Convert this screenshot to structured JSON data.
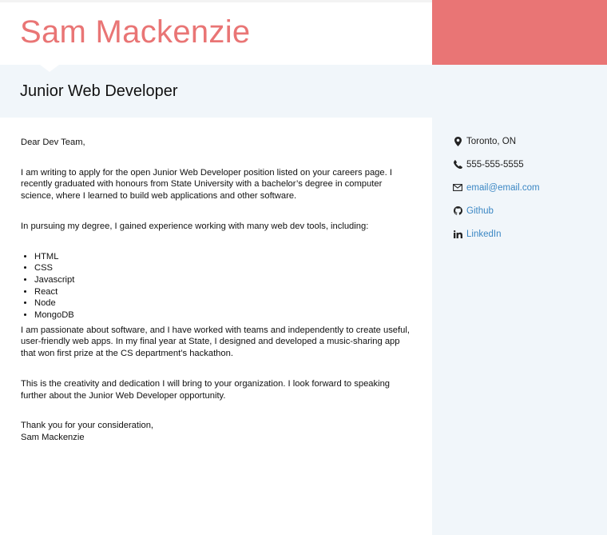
{
  "header": {
    "name": "Sam Mackenzie",
    "accent_color": "#e97575",
    "job_title": "Junior Web Developer"
  },
  "sidebar": {
    "background": "#f1f6fa",
    "contacts": [
      {
        "icon": "map-marker-icon",
        "text": "Toronto, ON",
        "link": false
      },
      {
        "icon": "phone-icon",
        "text": "555-555-5555",
        "link": false
      },
      {
        "icon": "envelope-icon",
        "text": "email@email.com",
        "link": true
      },
      {
        "icon": "github-icon",
        "text": "Github",
        "link": true
      },
      {
        "icon": "linkedin-icon",
        "text": "LinkedIn",
        "link": true
      }
    ],
    "link_color": "#3b87c4"
  },
  "letter": {
    "salutation": "Dear Dev Team,",
    "paragraph1": "I am writing to apply for the open Junior Web Developer position listed on your careers page. I recently graduated with honours from State University with a bachelor’s degree in computer science, where I learned to build web applications and other software.",
    "paragraph2": "In pursuing my degree, I gained experience working with many web dev tools, including:",
    "tools": [
      "HTML",
      "CSS",
      "Javascript",
      "React",
      "Node",
      "MongoDB"
    ],
    "paragraph3": "I am passionate about software, and I have worked with teams and independently to create useful, user-friendly web apps. In my final year at State, I designed and developed a music-sharing app that won first prize at the CS department’s hackathon.",
    "paragraph4": "This is the creativity and dedication I will bring to your organization. I look forward to speaking further about the Junior Web Developer opportunity.",
    "closing": "Thank you for your consideration,",
    "signature": "Sam Mackenzie"
  }
}
